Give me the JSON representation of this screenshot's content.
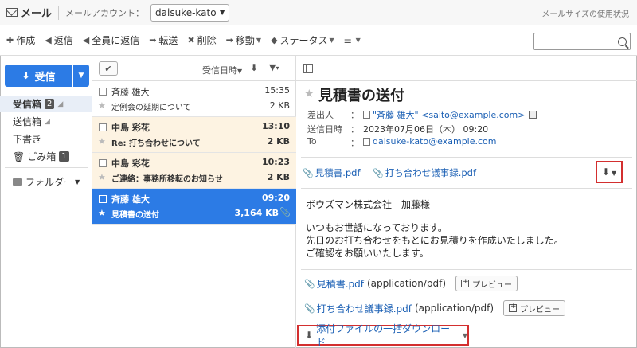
{
  "topbar": {
    "app_title": "メール",
    "account_label": "メールアカウント：",
    "account_value": "daisuke-kato",
    "mail_size_link": "メールサイズの使用状況"
  },
  "toolbar": {
    "compose": "作成",
    "reply": "返信",
    "reply_all": "全員に返信",
    "forward": "転送",
    "delete": "削除",
    "move": "移動",
    "status": "ステータス"
  },
  "sidebar": {
    "receive_label": "受信",
    "folders": [
      {
        "label": "受信箱",
        "badge": "2"
      },
      {
        "label": "送信箱",
        "badge": ""
      },
      {
        "label": "下書き",
        "badge": ""
      },
      {
        "label": "ごみ箱",
        "badge": "1"
      }
    ],
    "folder_menu": "フォルダー"
  },
  "list": {
    "sort_label": "受信日時",
    "rows": [
      {
        "sender": "斉藤 雄大",
        "time": "15:35",
        "subject": "定例会の延期について",
        "size": "2 KB"
      },
      {
        "sender": "中島 彩花",
        "time": "13:10",
        "subject": "Re: 打ち合わせについて",
        "size": "2 KB"
      },
      {
        "sender": "中島 彩花",
        "time": "10:23",
        "subject": "ご連絡：事務所移転のお知らせ",
        "size": "2 KB"
      },
      {
        "sender": "斉藤 雄大",
        "time": "09:20",
        "subject": "見積書の送付",
        "size": "3,164 KB"
      }
    ]
  },
  "mail": {
    "title": "見積書の送付",
    "from_label": "差出人",
    "from_name": "\"斉藤 雄大\"",
    "from_email": "<saito@example.com>",
    "date_label": "送信日時",
    "date_value": "2023年07月06日（木） 09:20",
    "to_label": "To",
    "to_value": "daisuke-kato@example.com",
    "colon": "：",
    "attachments": [
      "見積書.pdf",
      "打ち合わせ議事録.pdf"
    ],
    "body": [
      "ボウズマン株式会社　加藤様",
      "いつもお世話になっております。",
      "先日のお打ち合わせをもとにお見積りを作成いたしました。",
      "ご確認をお願いいたします。"
    ],
    "attachment_rows": [
      {
        "name": "見積書.pdf",
        "type": "(application/pdf)",
        "preview": "プレビュー"
      },
      {
        "name": "打ち合わせ議事録.pdf",
        "type": "(application/pdf)",
        "preview": "プレビュー"
      }
    ],
    "bulk_download": "添付ファイルの一括ダウンロード"
  },
  "colors": {
    "accent": "#2c7be5",
    "highlight": "#d32f2f",
    "unread_bg": "#fdf3e2",
    "link": "#1a5fb4"
  }
}
